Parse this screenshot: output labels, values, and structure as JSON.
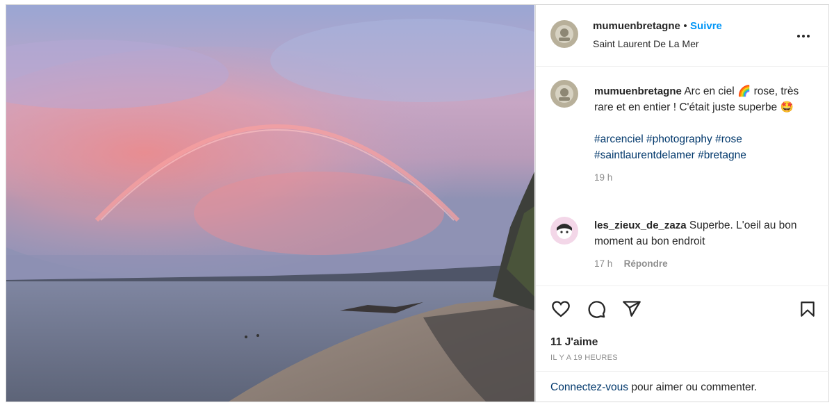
{
  "post": {
    "username": "mumuenbretagne",
    "dot": "•",
    "follow_label": "Suivre",
    "location": "Saint Laurent De La Mer"
  },
  "caption": {
    "username": "mumuenbretagne",
    "text_part1": "Arc en ciel 🌈 rose, très rare et en entier ! C'était juste superbe 🤩",
    "hashtags": [
      "#arcenciel",
      "#photography",
      "#rose",
      "#saintlaurentdelamer",
      "#bretagne"
    ],
    "time": "19 h"
  },
  "comment": {
    "username": "les_zieux_de_zaza",
    "text": "Superbe. L'oeil au bon moment au bon endroit",
    "time": "17 h",
    "reply_label": "Répondre"
  },
  "stats": {
    "likes": "11 J'aime",
    "ago": "IL Y A 19 HEURES"
  },
  "login": {
    "link": "Connectez-vous",
    "rest": " pour aimer ou commenter."
  },
  "icons": {
    "like": "heart-icon",
    "comment": "comment-icon",
    "share": "paper-plane-icon",
    "save": "bookmark-icon",
    "more": "more-options-icon"
  }
}
